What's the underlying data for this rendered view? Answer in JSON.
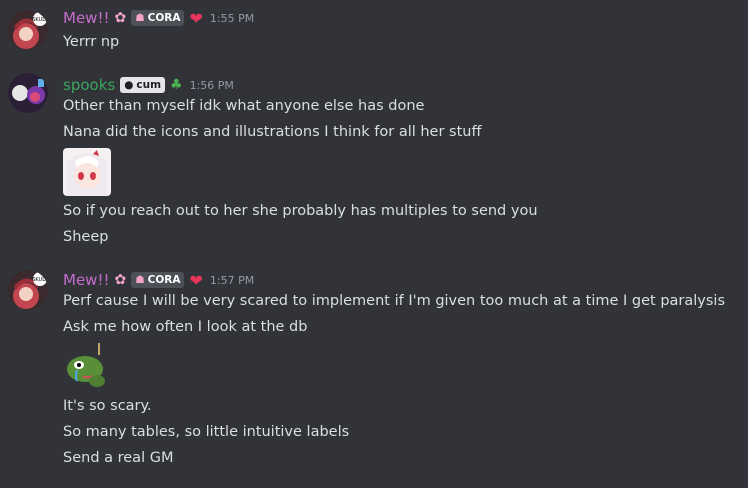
{
  "messages": [
    {
      "author": "Mew!!",
      "author_color": "#c66ccc",
      "tag_label": "CORA",
      "timestamp": "1:55 PM",
      "lines": [
        "Yerrr np"
      ]
    },
    {
      "author": "spooks",
      "author_color": "#3ba55d",
      "tag_label": "cum",
      "timestamp": "1:56 PM",
      "lines": [
        "Other than myself idk what anyone else has done",
        "Nana did the icons and illustrations I think for all her stuff",
        "So if you reach out to her she probably has multiples to send you",
        "Sheep"
      ]
    },
    {
      "author": "Mew!!",
      "author_color": "#c66ccc",
      "tag_label": "CORA",
      "timestamp": "1:57 PM",
      "lines": [
        "Perf cause I will be very scared to implement if I'm given too much at a time I get paralysis",
        "Ask me how often I look at the db",
        "It's so scary.",
        "So many tables, so little intuitive labels",
        "Send a real GM"
      ]
    }
  ]
}
